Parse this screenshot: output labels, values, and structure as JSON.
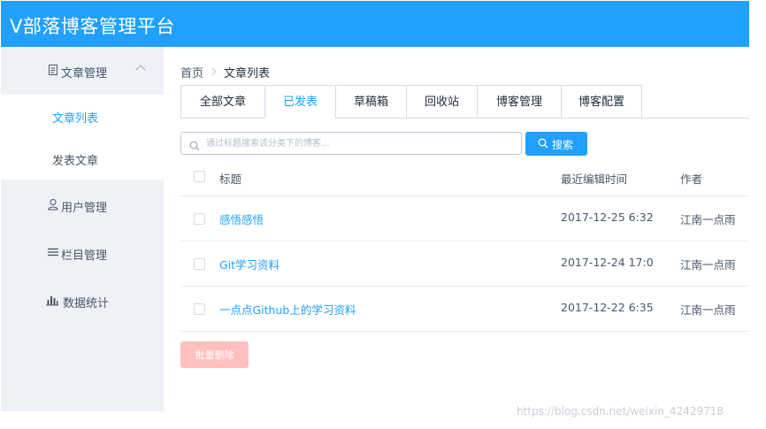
{
  "app": {
    "title": "V部落博客管理平台"
  },
  "sidebar": {
    "groups": [
      {
        "label": "文章管理",
        "icon": "document-icon",
        "expanded": true,
        "children": [
          {
            "label": "文章列表",
            "active": true
          },
          {
            "label": "发表文章",
            "active": false
          }
        ]
      },
      {
        "label": "用户管理",
        "icon": "user-icon"
      },
      {
        "label": "栏目管理",
        "icon": "list-icon"
      },
      {
        "label": "数据统计",
        "icon": "bar-chart-icon"
      }
    ]
  },
  "breadcrumb": {
    "home": "首页",
    "current": "文章列表"
  },
  "tabs": [
    {
      "label": "全部文章"
    },
    {
      "label": "已发表",
      "active": true
    },
    {
      "label": "草稿箱"
    },
    {
      "label": "回收站"
    },
    {
      "label": "博客管理"
    },
    {
      "label": "博客配置"
    }
  ],
  "search": {
    "placeholder": "通过标题搜索该分类下的博客...",
    "button_label": "搜索"
  },
  "table": {
    "headers": {
      "title": "标题",
      "time": "最近编辑时间",
      "author": "作者"
    },
    "rows": [
      {
        "title": "感悟感悟",
        "time": "2017-12-25 6:32",
        "author": "江南一点雨"
      },
      {
        "title": "Git学习资料",
        "time": "2017-12-24 17:0",
        "author": "江南一点雨"
      },
      {
        "title": "一点点Github上的学习资料",
        "time": "2017-12-22 6:35",
        "author": "江南一点雨"
      }
    ]
  },
  "actions": {
    "batch_delete_label": "批量删除"
  },
  "watermark": "https://blog.csdn.net/weixin_42429718",
  "colors": {
    "primary": "#20a0ff",
    "sidebar_bg": "#eef1f6",
    "danger_disabled": "#ffbfbf"
  }
}
